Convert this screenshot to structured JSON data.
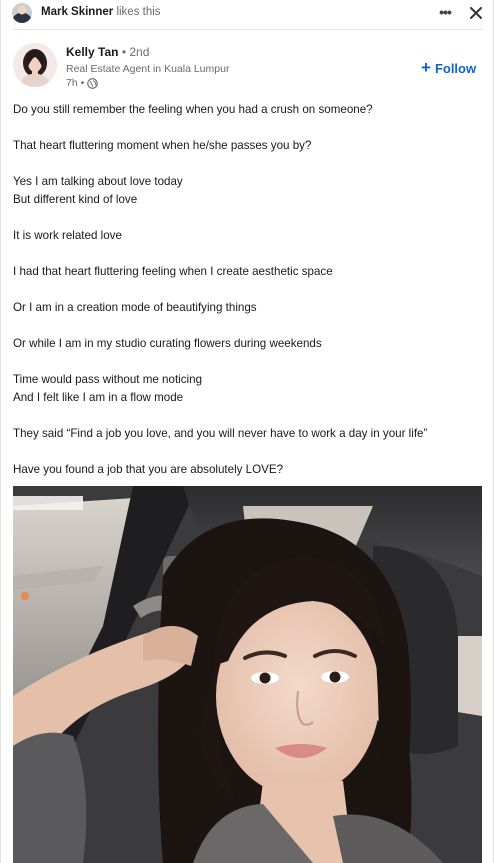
{
  "social_context": {
    "name": "Mark Skinner",
    "action": "likes this"
  },
  "icons": {
    "more": "more-options-icon",
    "close": "close-icon",
    "globe": "globe-icon",
    "plus": "plus-icon"
  },
  "author": {
    "name": "Kelly Tan",
    "degree": "• 2nd",
    "headline": "Real Estate Agent in Kuala Lumpur",
    "time": "7h •"
  },
  "follow_label": "Follow",
  "colors": {
    "accent": "#0a66c2",
    "text_primary": "#191919",
    "text_secondary": "#6b6b6b"
  },
  "post": {
    "paragraphs": [
      [
        "Do you still remember the feeling when you had a crush on someone?"
      ],
      [
        "That heart fluttering moment when he/she passes you by?"
      ],
      [
        "Yes I am talking about love today",
        "But different kind of love"
      ],
      [
        "It is work related love"
      ],
      [
        "I had that heart fluttering feeling when I create aesthetic space"
      ],
      [
        "Or I am in a creation mode of beautifying things"
      ],
      [
        "Or while I am in my studio curating flowers during weekends"
      ],
      [
        "Time would pass without me noticing",
        "And I felt like I am in a flow mode"
      ],
      [
        "They said “Find a job you love, and you will never have to work a day in your life”"
      ],
      [
        "Have you found a job that you are absolutely LOVE?"
      ]
    ]
  }
}
